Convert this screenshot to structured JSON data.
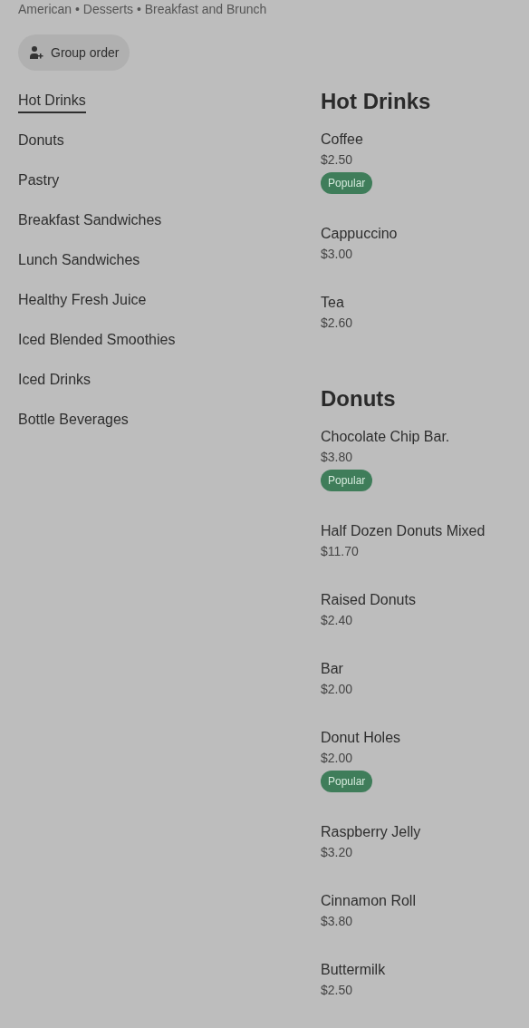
{
  "cuisines": "American • Desserts • Breakfast and Brunch",
  "group_order_button": {
    "label": "Group order"
  },
  "nav": [
    {
      "label": "Hot Drinks",
      "selected": true
    },
    {
      "label": "Donuts",
      "selected": false
    },
    {
      "label": "Pastry",
      "selected": false
    },
    {
      "label": "Breakfast Sandwiches",
      "selected": false
    },
    {
      "label": "Lunch Sandwiches",
      "selected": false
    },
    {
      "label": "Healthy Fresh Juice",
      "selected": false
    },
    {
      "label": "Iced Blended Smoothies",
      "selected": false
    },
    {
      "label": "Iced Drinks",
      "selected": false
    },
    {
      "label": "Bottle Beverages",
      "selected": false
    }
  ],
  "sections": [
    {
      "title": "Hot Drinks",
      "items": [
        {
          "name": "Coffee",
          "price": "$2.50",
          "badge": "Popular"
        },
        {
          "name": "Cappuccino",
          "price": "$3.00"
        },
        {
          "name": "Tea",
          "price": "$2.60"
        }
      ]
    },
    {
      "title": "Donuts",
      "items": [
        {
          "name": "Chocolate Chip Bar.",
          "price": "$3.80",
          "badge": "Popular"
        },
        {
          "name": "Half Dozen Donuts Mixed",
          "price": "$11.70"
        },
        {
          "name": "Raised Donuts",
          "price": "$2.40"
        },
        {
          "name": "Bar",
          "price": "$2.00"
        },
        {
          "name": "Donut Holes",
          "price": "$2.00",
          "badge": "Popular"
        },
        {
          "name": "Raspberry Jelly",
          "price": "$3.20"
        },
        {
          "name": "Cinnamon Roll",
          "price": "$3.80"
        },
        {
          "name": "Buttermilk",
          "price": "$2.50"
        }
      ]
    }
  ]
}
